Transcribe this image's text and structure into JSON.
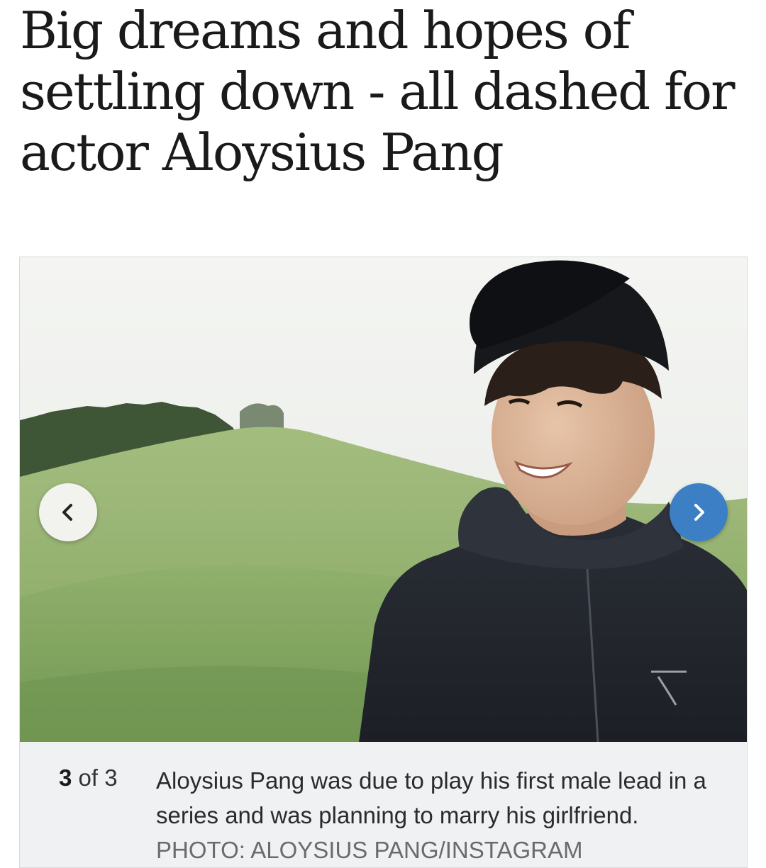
{
  "article": {
    "headline": "Big dreams and hopes of settling down - all dashed for actor Aloysius Pang"
  },
  "gallery": {
    "photo_alt": "Aloysius Pang in a black cap and hoodie on a grassy hill",
    "current": "3",
    "of_label": "of",
    "total": "3",
    "caption": "Aloysius Pang was due to play his first male lead in a series and was planning to marry his girlfriend.",
    "credit": "PHOTO: ALOYSIUS PANG/INSTAGRAM",
    "prev_icon": "chevron-left-icon",
    "next_icon": "chevron-right-icon",
    "colors": {
      "next_button": "#3d7fc4",
      "prev_button": "#f2f2ef",
      "caption_background": "#eff1f3"
    }
  }
}
